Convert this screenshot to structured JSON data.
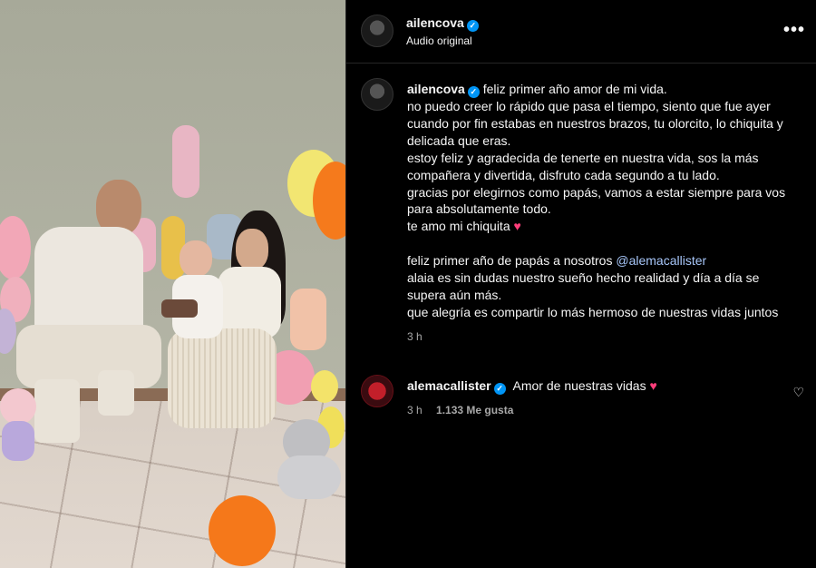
{
  "header": {
    "username": "ailencova",
    "subtitle": "Audio original",
    "more_label": "•••"
  },
  "caption": {
    "username": "ailencova",
    "lines": [
      "feliz primer año amor de mi vida.",
      "no puedo creer lo rápido que pasa el tiempo, siento que fue ayer cuando por fin estabas en nuestros brazos, tu olorcito, lo chiquita y delicada que eras.",
      "estoy feliz y agradecida de tenerte en nuestra vida, sos la más compañera y divertida, disfruto cada segundo a tu lado.",
      "gracias por elegirnos como papás, vamos a estar siempre para vos para absolutamente todo.",
      "te amo mi chiquita",
      "feliz primer año de papás a nosotros",
      "@alemacallister",
      "alaia es sin dudas nuestro sueño hecho realidad y día a día se supera aún más.",
      "que alegría es compartir lo más hermoso de nuestras vidas juntos"
    ],
    "heart": "♥",
    "time": "3 h"
  },
  "comment": {
    "username": "alemacallister",
    "text": "Amor de nuestras vidas",
    "heart": "♥",
    "time": "3 h",
    "likes": "1.133 Me gusta"
  },
  "icons": {
    "verified": "✓",
    "like": "♡"
  },
  "colors": {
    "background": "#000000",
    "verified": "#0095f6",
    "mention": "#a8c7fa",
    "heart": "#ff3d7a"
  }
}
